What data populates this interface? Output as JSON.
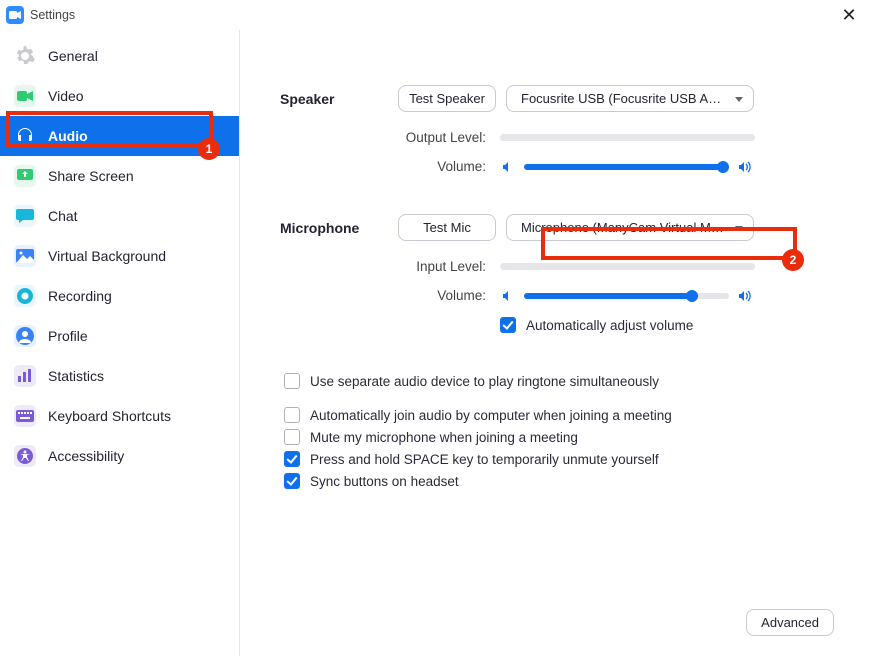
{
  "window": {
    "title": "Settings"
  },
  "sidebar": {
    "items": [
      {
        "label": "General"
      },
      {
        "label": "Video"
      },
      {
        "label": "Audio"
      },
      {
        "label": "Share Screen"
      },
      {
        "label": "Chat"
      },
      {
        "label": "Virtual Background"
      },
      {
        "label": "Recording"
      },
      {
        "label": "Profile"
      },
      {
        "label": "Statistics"
      },
      {
        "label": "Keyboard Shortcuts"
      },
      {
        "label": "Accessibility"
      }
    ]
  },
  "audio": {
    "speaker": {
      "heading": "Speaker",
      "testBtn": "Test Speaker",
      "device": "Focusrite USB (Focusrite USB Aud…",
      "outputLevelLabel": "Output Level:",
      "volumeLabel": "Volume:",
      "volumePercent": 97
    },
    "microphone": {
      "heading": "Microphone",
      "testBtn": "Test Mic",
      "device": "Microphone (ManyCam Virtual M…",
      "inputLevelLabel": "Input Level:",
      "volumeLabel": "Volume:",
      "volumePercent": 82,
      "autoAdjustLabel": "Automatically adjust volume",
      "autoAdjust": true
    },
    "options": {
      "ringtone": {
        "label": "Use separate audio device to play ringtone simultaneously",
        "checked": false
      },
      "autoJoin": {
        "label": "Automatically join audio by computer when joining a meeting",
        "checked": false
      },
      "muteOnJoin": {
        "label": "Mute my microphone when joining a meeting",
        "checked": false
      },
      "pushToTalk": {
        "label": "Press and hold SPACE key to temporarily unmute yourself",
        "checked": true
      },
      "syncHeadset": {
        "label": "Sync buttons on headset",
        "checked": true
      }
    },
    "advancedBtn": "Advanced"
  },
  "annotations": {
    "badge1": "1",
    "badge2": "2"
  }
}
